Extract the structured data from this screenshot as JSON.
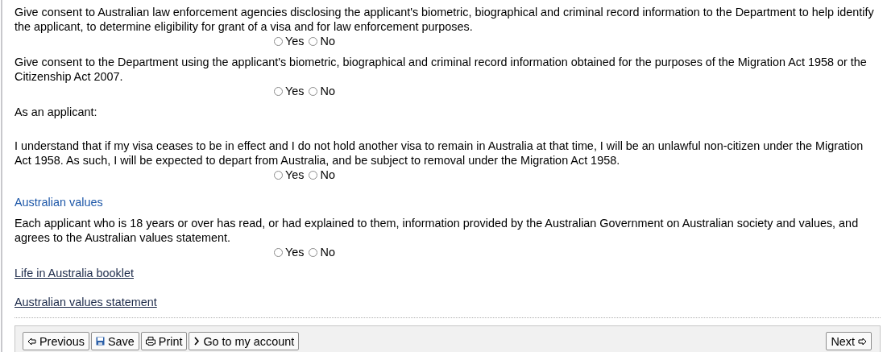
{
  "items": [
    {
      "kind": "question",
      "text": "Give consent to Australian law enforcement agencies disclosing the applicant's biometric, biographical and criminal record information to the Department to help identify the applicant, to determine eligibility for grant of a visa and for law enforcement purposes.",
      "options": [
        {
          "label": "Yes",
          "selected": false
        },
        {
          "label": "No",
          "selected": false
        }
      ]
    },
    {
      "kind": "question",
      "text": "Give consent to the Department using the applicant's biometric, biographical and criminal record information obtained for the purposes of the Migration Act 1958 or the Citizenship Act 2007.",
      "options": [
        {
          "label": "Yes",
          "selected": false
        },
        {
          "label": "No",
          "selected": false
        }
      ]
    },
    {
      "kind": "label",
      "text": "As an applicant:"
    },
    {
      "kind": "question",
      "text": "I understand that if my visa ceases to be in effect and I do not hold another visa to remain in Australia at that time, I will be an unlawful non-citizen under the Migration Act 1958. As such, I will be expected to depart from Australia, and be subject to removal under the Migration Act 1958.",
      "options": [
        {
          "label": "Yes",
          "selected": false
        },
        {
          "label": "No",
          "selected": false
        }
      ]
    },
    {
      "kind": "heading",
      "text": "Australian values"
    },
    {
      "kind": "question",
      "text": "Each applicant who is 18 years or over has read, or had explained to them, information provided by the Australian Government on Australian society and values, and agrees to the Australian values statement.",
      "options": [
        {
          "label": "Yes",
          "selected": false
        },
        {
          "label": "No",
          "selected": false
        }
      ]
    },
    {
      "kind": "link",
      "text": "Life in Australia booklet"
    },
    {
      "kind": "link",
      "text": "Australian values statement"
    }
  ],
  "toolbar": {
    "left": [
      {
        "kind": "previous",
        "label": "Previous"
      },
      {
        "kind": "save",
        "label": "Save"
      },
      {
        "kind": "print",
        "label": "Print"
      },
      {
        "kind": "account",
        "label": "Go to my account"
      }
    ],
    "right": [
      {
        "kind": "next",
        "label": "Next"
      }
    ]
  }
}
